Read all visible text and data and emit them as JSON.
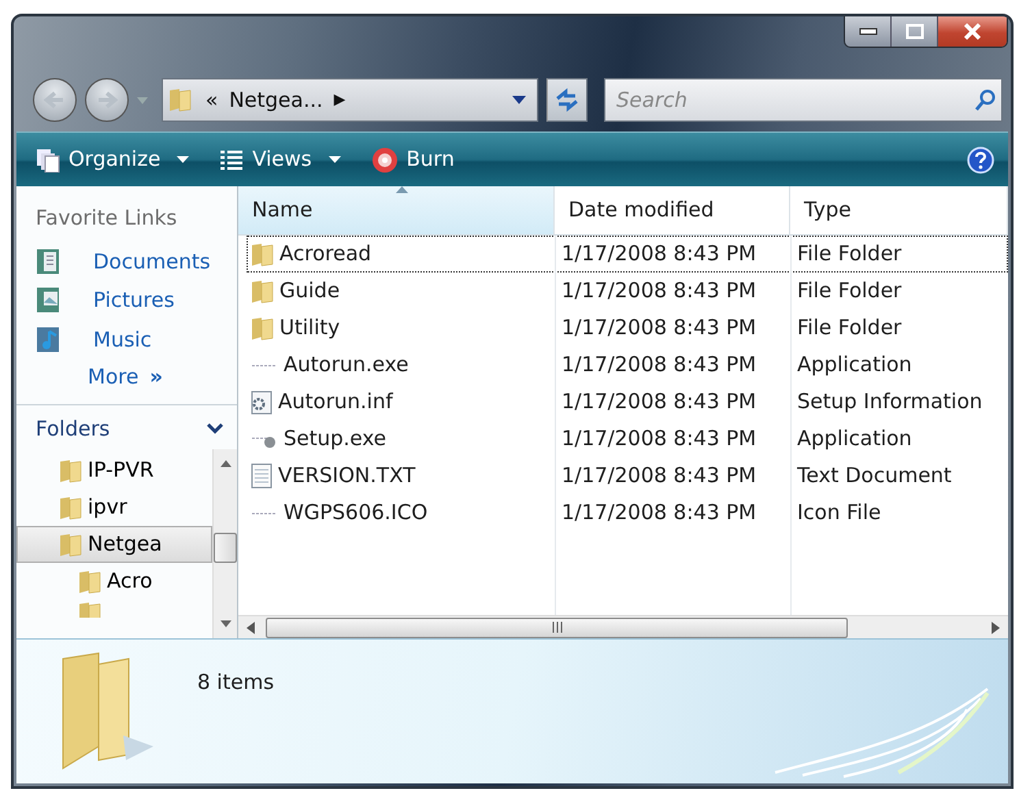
{
  "address_bar": {
    "prefix": "«",
    "path": "Netgea...",
    "separator": "▶"
  },
  "search": {
    "placeholder": "Search"
  },
  "toolbar": [
    {
      "kind": "organize",
      "label": "Organize",
      "caret": true
    },
    {
      "kind": "views",
      "label": "Views",
      "caret": true
    },
    {
      "kind": "burn",
      "label": "Burn",
      "caret": false
    }
  ],
  "favorite_links": {
    "title": "Favorite Links",
    "items": [
      {
        "kind": "documents",
        "label": "Documents"
      },
      {
        "kind": "pictures",
        "label": "Pictures"
      },
      {
        "kind": "music",
        "label": "Music"
      }
    ],
    "more": {
      "label": "More",
      "chevron": "»"
    }
  },
  "folders": {
    "title": "Folders",
    "expanded": true,
    "tree": [
      {
        "label": "IP-PVR",
        "selected": false
      },
      {
        "label": "ipvr",
        "selected": false
      },
      {
        "label": "Netgea",
        "selected": true,
        "children": [
          {
            "label": "Acro",
            "selected": false
          }
        ]
      }
    ]
  },
  "table": {
    "columns": [
      {
        "label": "Name",
        "sorted": true
      },
      {
        "label": "Date modified",
        "sorted": false
      },
      {
        "label": "Type",
        "sorted": false
      }
    ],
    "rows": [
      {
        "kind": "folder",
        "name": "Acroread",
        "date": "1/17/2008 8:43 PM",
        "type": "File Folder",
        "focused": true
      },
      {
        "kind": "folder",
        "name": "Guide",
        "date": "1/17/2008 8:43 PM",
        "type": "File Folder",
        "focused": false
      },
      {
        "kind": "folder",
        "name": "Utility",
        "date": "1/17/2008 8:43 PM",
        "type": "File Folder",
        "focused": false
      },
      {
        "kind": "exe",
        "name": "Autorun.exe",
        "date": "1/17/2008 8:43 PM",
        "type": "Application",
        "focused": false
      },
      {
        "kind": "inf",
        "name": "Autorun.inf",
        "date": "1/17/2008 8:43 PM",
        "type": "Setup Information",
        "focused": false
      },
      {
        "kind": "setup",
        "name": "Setup.exe",
        "date": "1/17/2008 8:43 PM",
        "type": "Application",
        "focused": false
      },
      {
        "kind": "txt",
        "name": "VERSION.TXT",
        "date": "1/17/2008 8:43 PM",
        "type": "Text Document",
        "focused": false
      },
      {
        "kind": "exe",
        "name": "WGPS606.ICO",
        "date": "1/17/2008 8:43 PM",
        "type": "Icon File",
        "focused": false
      }
    ]
  },
  "details_pane": {
    "summary": "8 items"
  }
}
